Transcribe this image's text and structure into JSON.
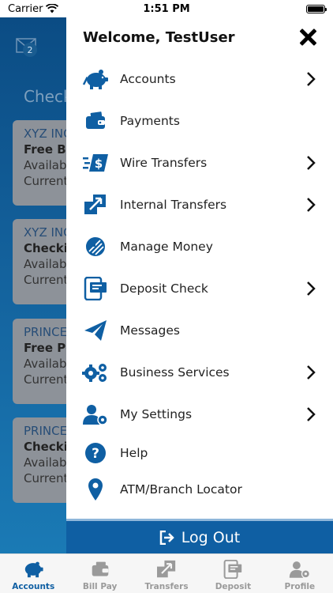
{
  "status_bar": {
    "carrier": "Carrier",
    "time": "1:51 PM"
  },
  "background": {
    "mail_badge": "2",
    "section_title": "Check",
    "cards": [
      {
        "bank": "XYZ INC",
        "account": "Free Bu",
        "line1": "Availab",
        "line2": "Current"
      },
      {
        "bank": "XYZ INC",
        "account": "Checki",
        "line1": "Availab",
        "line2": "Current"
      },
      {
        "bank": "PRINCE",
        "account": "Free Pe",
        "line1": "Availab",
        "line2": "Current"
      },
      {
        "bank": "PRINCE",
        "account": "Checki",
        "line1": "Availab",
        "line2": "Current"
      }
    ]
  },
  "drawer": {
    "welcome": "Welcome, TestUser",
    "items": [
      {
        "label": "Accounts",
        "icon": "piggy-bank-icon",
        "chevron": true
      },
      {
        "label": "Payments",
        "icon": "wallet-icon",
        "chevron": false
      },
      {
        "label": "Wire Transfers",
        "icon": "wire-transfer-icon",
        "chevron": true
      },
      {
        "label": "Internal Transfers",
        "icon": "internal-transfer-icon",
        "chevron": true
      },
      {
        "label": "Manage Money",
        "icon": "manage-money-icon",
        "chevron": false
      },
      {
        "label": "Deposit Check",
        "icon": "deposit-check-icon",
        "chevron": true
      },
      {
        "label": "Messages",
        "icon": "paper-plane-icon",
        "chevron": false
      },
      {
        "label": "Business Services",
        "icon": "gears-icon",
        "chevron": true
      },
      {
        "label": "My Settings",
        "icon": "user-settings-icon",
        "chevron": true
      },
      {
        "label": "Help",
        "icon": "help-icon",
        "chevron": false
      },
      {
        "label": "ATM/Branch Locator",
        "icon": "location-pin-icon",
        "chevron": false
      }
    ],
    "logout_label": "Log Out"
  },
  "tab_bar": {
    "tabs": [
      {
        "label": "Accounts",
        "icon": "piggy-bank-icon",
        "active": true
      },
      {
        "label": "Bill Pay",
        "icon": "wallet-icon",
        "active": false
      },
      {
        "label": "Transfers",
        "icon": "transfer-icon",
        "active": false
      },
      {
        "label": "Deposit",
        "icon": "deposit-icon",
        "active": false
      },
      {
        "label": "Profile",
        "icon": "profile-icon",
        "active": false
      }
    ]
  },
  "colors": {
    "brand_blue": "#0f5fa3",
    "tab_inactive": "#9a9a9a",
    "background_top": "#0b4c84"
  }
}
